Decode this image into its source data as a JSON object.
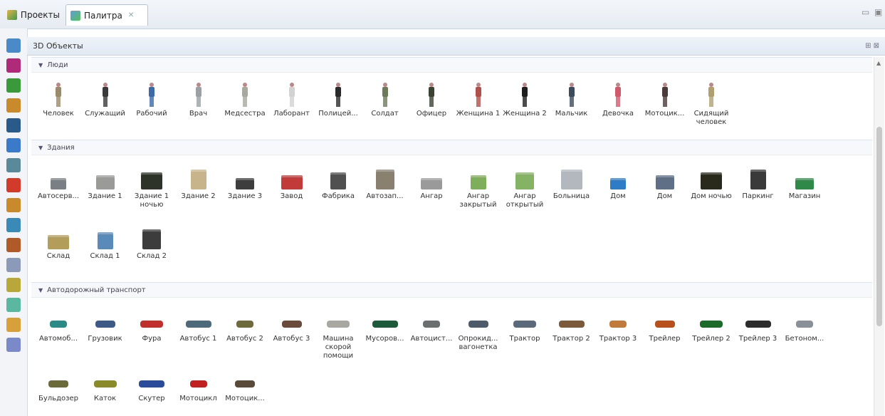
{
  "tabs": [
    {
      "label": "Проекты"
    },
    {
      "label": "Палитра"
    }
  ],
  "panel": {
    "title": "3D Объекты"
  },
  "sections": [
    {
      "title": "Люди",
      "kind": "person",
      "items": [
        {
          "label": "Человек",
          "color": "#9a8a6a"
        },
        {
          "label": "Служащий",
          "color": "#3a3a3a"
        },
        {
          "label": "Рабочий",
          "color": "#3a6aa8"
        },
        {
          "label": "Врач",
          "color": "#9aa0a4"
        },
        {
          "label": "Медсестра",
          "color": "#a8aaa0"
        },
        {
          "label": "Лаборант",
          "color": "#d2d2d2"
        },
        {
          "label": "Полицей...",
          "color": "#2a2a2a"
        },
        {
          "label": "Солдат",
          "color": "#6d7a5a"
        },
        {
          "label": "Офицер",
          "color": "#3a4232"
        },
        {
          "label": "Женщина 1",
          "color": "#b0504a"
        },
        {
          "label": "Женщина 2",
          "color": "#1e1e1e"
        },
        {
          "label": "Мальчик",
          "color": "#3b4b5b"
        },
        {
          "label": "Девочка",
          "color": "#d05a6a"
        },
        {
          "label": "Мотоцик...",
          "color": "#4a3a3a"
        },
        {
          "label": "Сидящий человек",
          "color": "#b0a070"
        }
      ]
    },
    {
      "title": "Здания",
      "kind": "building",
      "items": [
        {
          "label": "Автосерв...",
          "color": "#7a7f86"
        },
        {
          "label": "Здание 1",
          "color": "#9a9a98"
        },
        {
          "label": "Здание 1 ночью",
          "color": "#2d3328"
        },
        {
          "label": "Здание 2",
          "color": "#c8b48a"
        },
        {
          "label": "Здание 3",
          "color": "#3d3d3d"
        },
        {
          "label": "Завод",
          "color": "#c23a3a"
        },
        {
          "label": "Фабрика",
          "color": "#505050"
        },
        {
          "label": "Автозап...",
          "color": "#8a8070"
        },
        {
          "label": "Ангар",
          "color": "#9a9a9a"
        },
        {
          "label": "Ангар закрытый",
          "color": "#7fae5a"
        },
        {
          "label": "Ангар открытый",
          "color": "#84b364"
        },
        {
          "label": "Больница",
          "color": "#b2b8be"
        },
        {
          "label": "Дом",
          "color": "#2f7cc6"
        },
        {
          "label": "Дом",
          "color": "#5e6f86"
        },
        {
          "label": "Дом ночью",
          "color": "#2a2a1c"
        },
        {
          "label": "Паркинг",
          "color": "#3a3a3a"
        },
        {
          "label": "Магазин",
          "color": "#2f8a4a"
        },
        {
          "label": "Склад",
          "color": "#b39d5a"
        },
        {
          "label": "Склад 1",
          "color": "#5a8ab8"
        },
        {
          "label": "Склад 2",
          "color": "#3c3c3c"
        }
      ]
    },
    {
      "title": "Автодорожный транспорт",
      "kind": "vehicle",
      "items": [
        {
          "label": "Автомоб...",
          "color": "#2c8a86"
        },
        {
          "label": "Грузовик",
          "color": "#3c5a84"
        },
        {
          "label": "Фура",
          "color": "#c0302c"
        },
        {
          "label": "Автобус 1",
          "color": "#4e6a7a"
        },
        {
          "label": "Автобус 2",
          "color": "#6d6a3c"
        },
        {
          "label": "Автобус 3",
          "color": "#6a4a3a"
        },
        {
          "label": "Машина скорой помощи",
          "color": "#a8a8a0"
        },
        {
          "label": "Мусоров...",
          "color": "#1d5a3c"
        },
        {
          "label": "Автоцист...",
          "color": "#6c6f70"
        },
        {
          "label": "Опрокид... вагонетка",
          "color": "#4c5a6a"
        },
        {
          "label": "Трактор",
          "color": "#5a6a7a"
        },
        {
          "label": "Трактор 2",
          "color": "#7a5a3a"
        },
        {
          "label": "Трактор 3",
          "color": "#c07a3a"
        },
        {
          "label": "Трейлер",
          "color": "#b8501e"
        },
        {
          "label": "Трейлер 2",
          "color": "#1e6a2a"
        },
        {
          "label": "Трейлер 3",
          "color": "#2c2c2c"
        },
        {
          "label": "Бетоном...",
          "color": "#8a9098"
        },
        {
          "label": "Бульдозер",
          "color": "#6a6a3a"
        },
        {
          "label": "Каток",
          "color": "#8a8a2a"
        },
        {
          "label": "Скутер",
          "color": "#2a4a9a"
        },
        {
          "label": "Мотоцикл",
          "color": "#c02020"
        },
        {
          "label": "Мотоцик...",
          "color": "#5a4a3a"
        }
      ]
    }
  ],
  "leftbar_icons": [
    "target-icon",
    "chart-icon",
    "person-icon",
    "grid-icon",
    "car-icon",
    "drop-icon",
    "network-icon",
    "stop-icon",
    "box-icon",
    "tool-icon",
    "factory-icon",
    "panel-icon",
    "folder-icon",
    "palette-icon",
    "shape-icon",
    "shape2-icon"
  ]
}
